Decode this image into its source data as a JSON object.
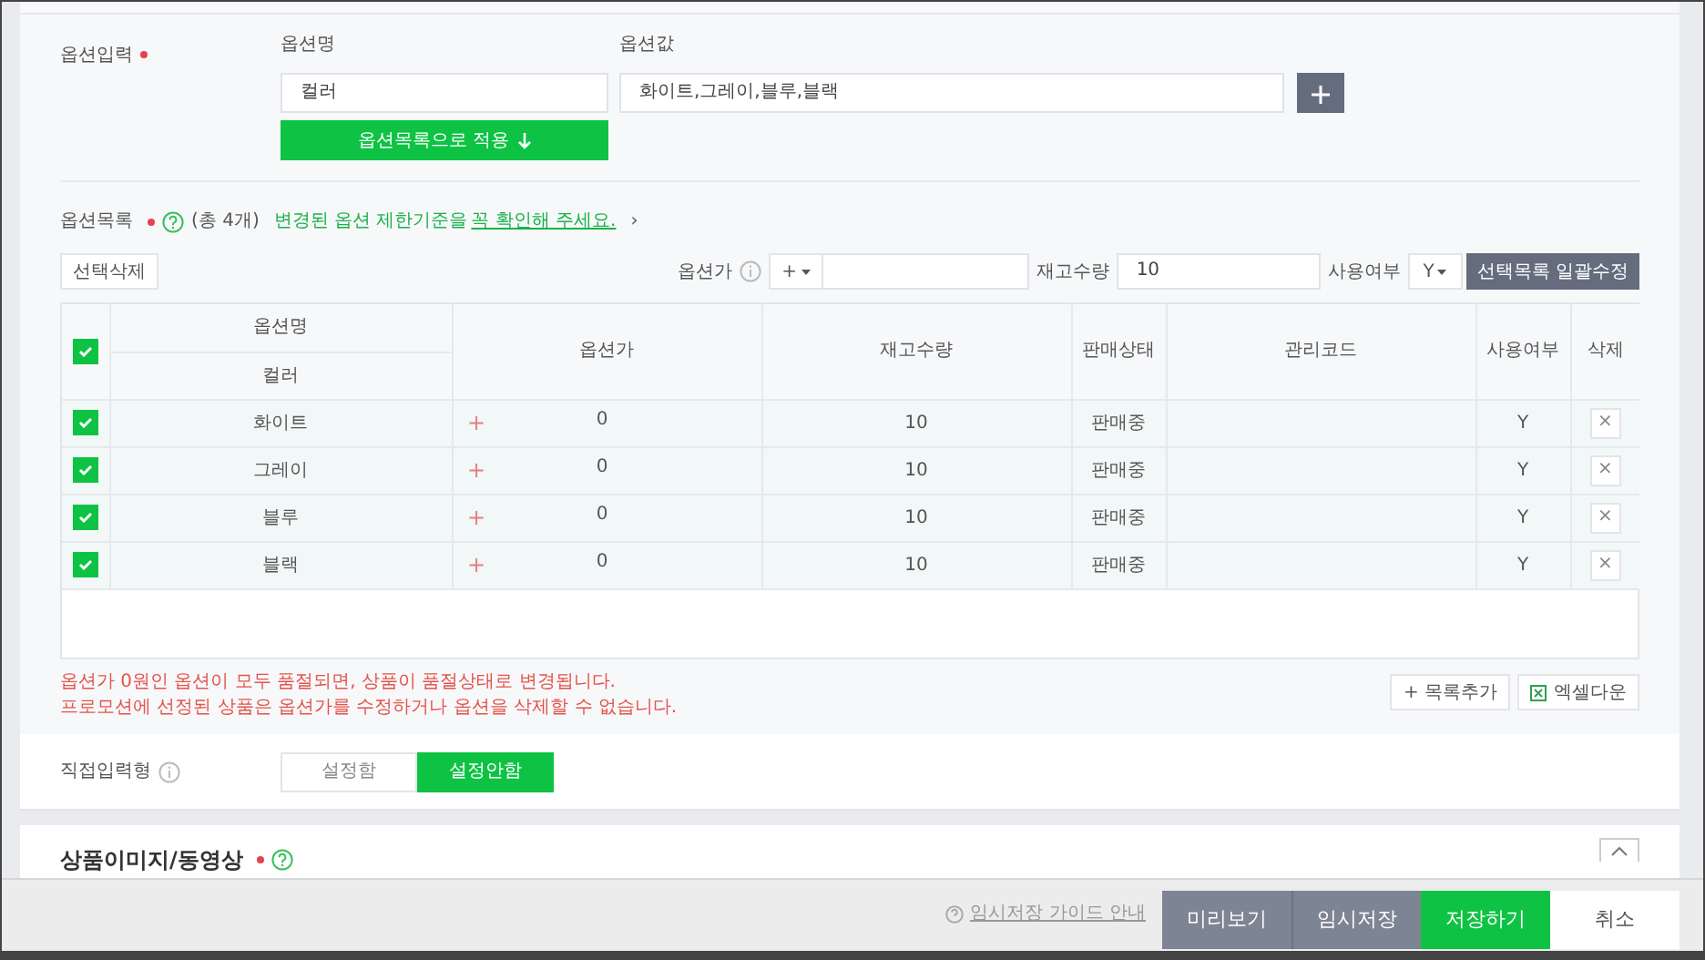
{
  "option_input": {
    "label": "옵션입력",
    "required": true,
    "name_label": "옵션명",
    "name_value": "컬러",
    "value_label": "옵션값",
    "value_value": "화이트,그레이,블루,블랙",
    "apply_button": "옵션목록으로 적용"
  },
  "option_list": {
    "label": "옵션목록",
    "required": true,
    "count": "(총 4개)",
    "notice": "변경된 옵션 제한기준을",
    "notice_link": "꼭 확인해 주세요.",
    "chevron": "›"
  },
  "toolbar": {
    "delete_button": "선택삭제",
    "price_label": "옵션가",
    "sign_select": "+",
    "stock_label": "재고수량",
    "stock_value": "10",
    "use_label": "사용여부",
    "use_select": "Y",
    "bulk_button": "선택목록 일괄수정"
  },
  "table": {
    "all_checked": true,
    "columns": [
      {
        "label": "옵션명",
        "sub": "컬러"
      },
      {
        "label": "옵션가"
      },
      {
        "label": "재고수량"
      },
      {
        "label": "판매상태"
      },
      {
        "label": "관리코드"
      },
      {
        "label": "사용여부"
      },
      {
        "label": "삭제"
      }
    ],
    "rows": [
      {
        "checked": true,
        "name": "화이트",
        "price_sign": "+",
        "price": "0",
        "stock": "10",
        "status": "판매중",
        "use": "Y",
        "delete": "×"
      },
      {
        "checked": true,
        "name": "그레이",
        "price_sign": "+",
        "price": "0",
        "stock": "10",
        "status": "판매중",
        "use": "Y",
        "delete": "×"
      },
      {
        "checked": true,
        "name": "블루",
        "price_sign": "+",
        "price": "0",
        "stock": "10",
        "status": "판매중",
        "use": "Y",
        "delete": "×"
      },
      {
        "checked": true,
        "name": "블랙",
        "price_sign": "+",
        "price": "0",
        "stock": "10",
        "status": "판매중",
        "use": "Y",
        "delete": "×"
      }
    ]
  },
  "notes": [
    "옵션가 0원인 옵션이 모두 품절되면, 상품이 품절상태로 변경됩니다.",
    "프로모션에 선정된 상품은 옵션가를 수정하거나 옵션을 삭제할 수 없습니다."
  ],
  "list_buttons": {
    "add": "+ 목록추가",
    "excel": "엑셀다운"
  },
  "direct_input": {
    "label": "직접입력형",
    "options": [
      {
        "label": "설정함",
        "selected": false
      },
      {
        "label": "설정안함",
        "selected": true
      }
    ]
  },
  "media_section": {
    "title": "상품이미지/동영상",
    "required": true
  },
  "footer": {
    "guide_link": "임시저장 가이드 안내",
    "buttons": [
      {
        "label": "미리보기",
        "kind": "secondary"
      },
      {
        "label": "임시저장",
        "kind": "secondary"
      },
      {
        "label": "저장하기",
        "kind": "primary"
      },
      {
        "label": "취소",
        "kind": "plain"
      }
    ]
  }
}
